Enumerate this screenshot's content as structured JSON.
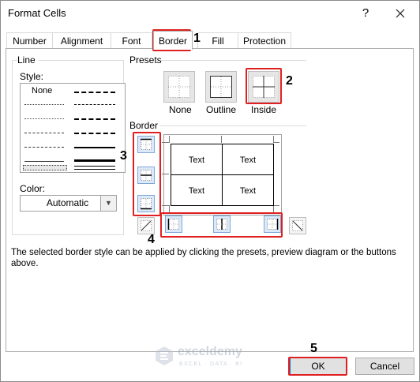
{
  "window": {
    "title": "Format Cells",
    "help": "?"
  },
  "tabs": [
    {
      "label": "Number"
    },
    {
      "label": "Alignment"
    },
    {
      "label": "Font"
    },
    {
      "label": "Border"
    },
    {
      "label": "Fill"
    },
    {
      "label": "Protection"
    }
  ],
  "line_group": {
    "title": "Line",
    "style_label": "Style:",
    "style_none": "None",
    "color_label": "Color:",
    "color_value": "Automatic"
  },
  "presets": {
    "title": "Presets",
    "items": [
      {
        "label": "None"
      },
      {
        "label": "Outline"
      },
      {
        "label": "Inside"
      }
    ]
  },
  "border": {
    "title": "Border",
    "preview_cells": [
      "Text",
      "Text",
      "Text",
      "Text"
    ]
  },
  "info_text": "The selected border style can be applied by clicking the presets, preview diagram or the buttons above.",
  "buttons": {
    "ok": "OK",
    "cancel": "Cancel"
  },
  "step_numbers": [
    "1",
    "2",
    "3",
    "4",
    "5"
  ],
  "watermark": {
    "name": "exceldemy",
    "tagline": "EXCEL · DATA · BI"
  },
  "colors": {
    "highlight": "#e02020",
    "selected_button_fill": "#dbe9f8",
    "selected_button_border": "#7fa7d8",
    "ok_border": "#0078d7"
  }
}
